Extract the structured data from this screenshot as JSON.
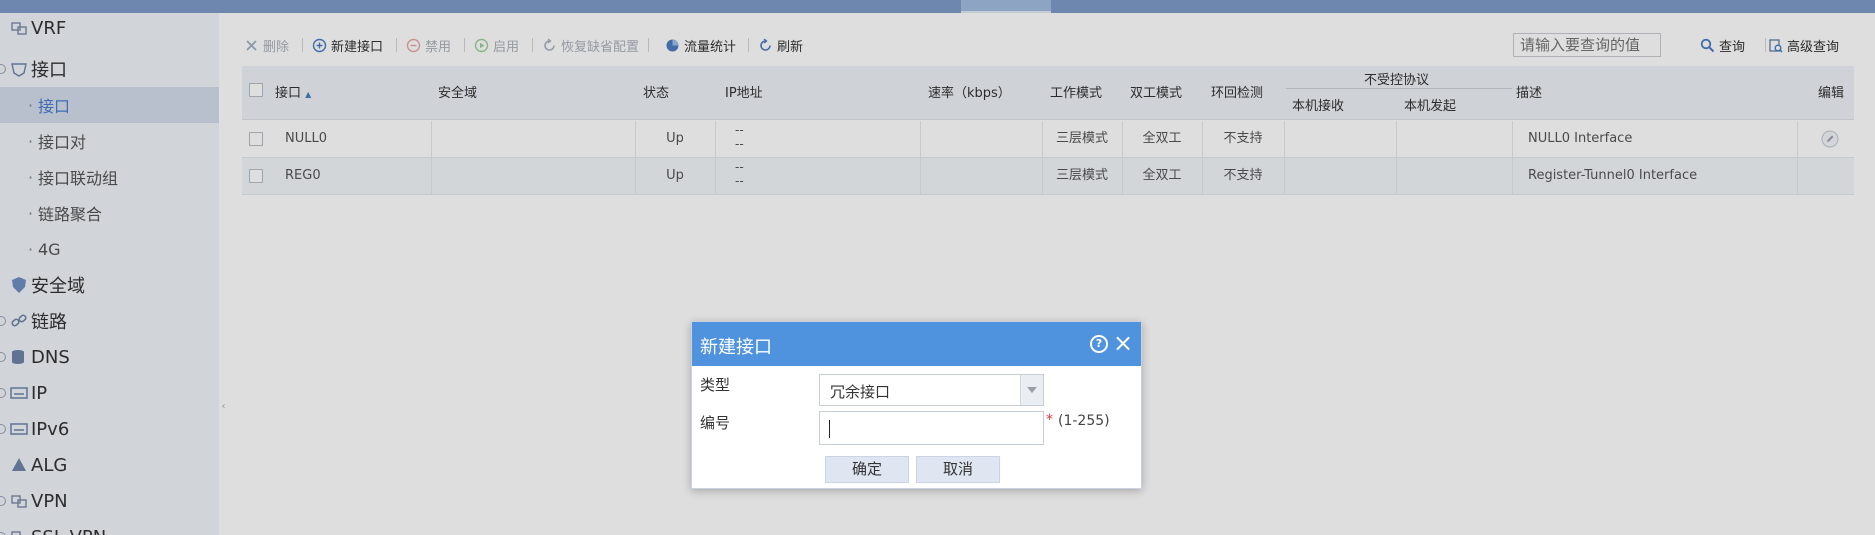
{
  "sidebar": {
    "items": [
      {
        "label": "VRF",
        "icon": "vrf-icon",
        "type": "top"
      },
      {
        "label": "接口",
        "icon": "interface-shield-icon",
        "type": "top"
      },
      {
        "label": "接口",
        "type": "sub",
        "active": true
      },
      {
        "label": "接口对",
        "type": "sub"
      },
      {
        "label": "接口联动组",
        "type": "sub"
      },
      {
        "label": "链路聚合",
        "type": "sub"
      },
      {
        "label": "4G",
        "type": "sub"
      },
      {
        "label": "安全域",
        "icon": "security-zone-icon",
        "type": "top"
      },
      {
        "label": "链路",
        "icon": "link-icon",
        "type": "top"
      },
      {
        "label": "DNS",
        "icon": "dns-icon",
        "type": "top"
      },
      {
        "label": "IP",
        "icon": "ip-icon",
        "type": "top"
      },
      {
        "label": "IPv6",
        "icon": "ipv6-icon",
        "type": "top"
      },
      {
        "label": "ALG",
        "icon": "alg-icon",
        "type": "top"
      },
      {
        "label": "VPN",
        "icon": "vpn-icon",
        "type": "top"
      },
      {
        "label": "SSL VPN",
        "icon": "ssl-vpn-icon",
        "type": "top"
      }
    ]
  },
  "toolbar": {
    "delete": "删除",
    "new_interface": "新建接口",
    "disable": "禁用",
    "enable": "启用",
    "restore_default": "恢复缺省配置",
    "traffic_stats": "流量统计",
    "refresh": "刷新",
    "search_placeholder": "请输入要查询的值",
    "search": "查询",
    "advanced_search": "高级查询"
  },
  "table": {
    "headers": {
      "interface": "接口",
      "security_zone": "安全域",
      "status": "状态",
      "ip": "IP地址",
      "speed": "速率（kbps）",
      "work_mode": "工作模式",
      "duplex": "双工模式",
      "loop_detect": "环回检测",
      "uncontrolled": "不受控协议",
      "local_recv": "本机接收",
      "local_send": "本机发起",
      "description": "描述",
      "edit": "编辑"
    },
    "rows": [
      {
        "name": "NULL0",
        "zone": "",
        "status": "Up",
        "ip1": "--",
        "ip2": "--",
        "speed": "",
        "mode": "三层模式",
        "duplex": "全双工",
        "loop": "不支持",
        "recv": "",
        "send": "",
        "desc": "NULL0 Interface"
      },
      {
        "name": "REG0",
        "zone": "",
        "status": "Up",
        "ip1": "--",
        "ip2": "--",
        "speed": "",
        "mode": "三层模式",
        "duplex": "全双工",
        "loop": "不支持",
        "recv": "",
        "send": "",
        "desc": "Register-Tunnel0 Interface"
      }
    ]
  },
  "dialog": {
    "title": "新建接口",
    "help": "?",
    "close": "×",
    "type_label": "类型",
    "type_value": "冗余接口",
    "number_label": "编号",
    "number_value": "",
    "required_mark": "*",
    "range_hint": "(1-255)",
    "ok": "确定",
    "cancel": "取消"
  },
  "colors": {
    "dialog_header": "#4f92de",
    "active_nav_text": "#4a7bd0",
    "topbar": "#7e9cc8"
  }
}
